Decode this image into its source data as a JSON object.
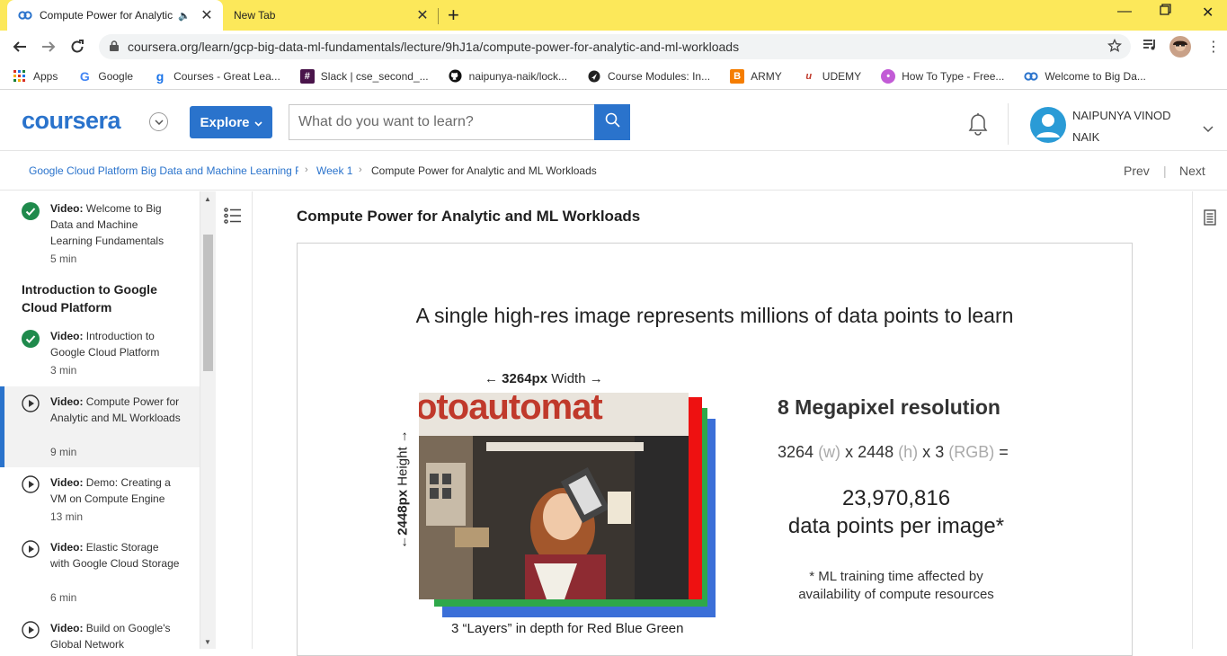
{
  "browser": {
    "tabs": [
      {
        "title": "Compute Power for Analytic",
        "active": true
      },
      {
        "title": "New Tab",
        "active": false
      }
    ],
    "url": "coursera.org/learn/gcp-big-data-ml-fundamentals/lecture/9hJ1a/compute-power-for-analytic-and-ml-workloads",
    "bookmarks": [
      {
        "label": "Apps",
        "icon": "apps-grid-icon"
      },
      {
        "label": "Google",
        "icon": "google-icon"
      },
      {
        "label": "Courses - Great Lea...",
        "icon": "great-learning-icon"
      },
      {
        "label": "Slack | cse_second_...",
        "icon": "slack-icon"
      },
      {
        "label": "naipunya-naik/lock...",
        "icon": "github-icon"
      },
      {
        "label": "Course Modules: In...",
        "icon": "course-modules-icon"
      },
      {
        "label": "ARMY",
        "icon": "blogger-icon"
      },
      {
        "label": "UDEMY",
        "icon": "udemy-icon"
      },
      {
        "label": "How To Type - Free...",
        "icon": "typing-icon"
      },
      {
        "label": "Welcome to Big Da...",
        "icon": "coursera-icon"
      }
    ]
  },
  "header": {
    "logo": "coursera",
    "explore_label": "Explore",
    "search_placeholder": "What do you want to learn?",
    "user_name_line1": "NAIPUNYA VINOD",
    "user_name_line2": "NAIK"
  },
  "breadcrumb": {
    "course": "Google Cloud Platform Big Data and Machine Learning F",
    "week": "Week 1",
    "current": "Compute Power for Analytic and ML Workloads",
    "prev": "Prev",
    "next": "Next"
  },
  "sidebar": {
    "item_welcome": {
      "kind": "Video:",
      "title": "Welcome to Big Data and Machine Learning Fundamentals",
      "duration": "5 min",
      "status": "completed"
    },
    "section_heading": "Introduction to Google Cloud Platform",
    "items": [
      {
        "kind": "Video:",
        "title": "Introduction to Google Cloud Platform",
        "duration": "3 min",
        "status": "completed"
      },
      {
        "kind": "Video:",
        "title": "Compute Power for Analytic and ML Workloads",
        "duration": "9 min",
        "status": "current"
      },
      {
        "kind": "Video:",
        "title": "Demo: Creating a VM on Compute Engine",
        "duration": "13 min",
        "status": "not-started"
      },
      {
        "kind": "Video:",
        "title": "Elastic Storage with Google Cloud Storage",
        "duration": "6 min",
        "status": "not-started"
      },
      {
        "kind": "Video:",
        "title": "Build on Google's Global Network",
        "duration": "",
        "status": "not-started"
      }
    ]
  },
  "lecture": {
    "title": "Compute Power for Analytic and ML Workloads",
    "slide": {
      "headline": "A single high-res image represents millions of data points to learn",
      "width_label_bold": "3264px",
      "width_label_rest": "Width",
      "height_label_bold": "2448px",
      "height_label_rest": "Height",
      "photo_sign_text": "otoautomat",
      "layers_caption": "3 “Layers” in depth for Red Blue Green",
      "mp_title": "8 Megapixel resolution",
      "formula": {
        "w_val": "3264",
        "w_unit": "(w)",
        "x1": "x",
        "h_val": "2448",
        "h_unit": "(h)",
        "x2": "x",
        "d_val": "3",
        "d_unit": "(RGB)",
        "eq": "="
      },
      "result_number": "23,970,816",
      "result_text": "data points per image*",
      "footnote_line1": "* ML training time affected by",
      "footnote_line2": "availability of compute resources",
      "layer_colors": {
        "red": "#ee1111",
        "green": "#2ea84a",
        "blue": "#3b6fd8"
      }
    }
  },
  "colors": {
    "brand": "#2a73cc",
    "tabbar": "#fce85a",
    "complete": "#1f8a4c"
  }
}
